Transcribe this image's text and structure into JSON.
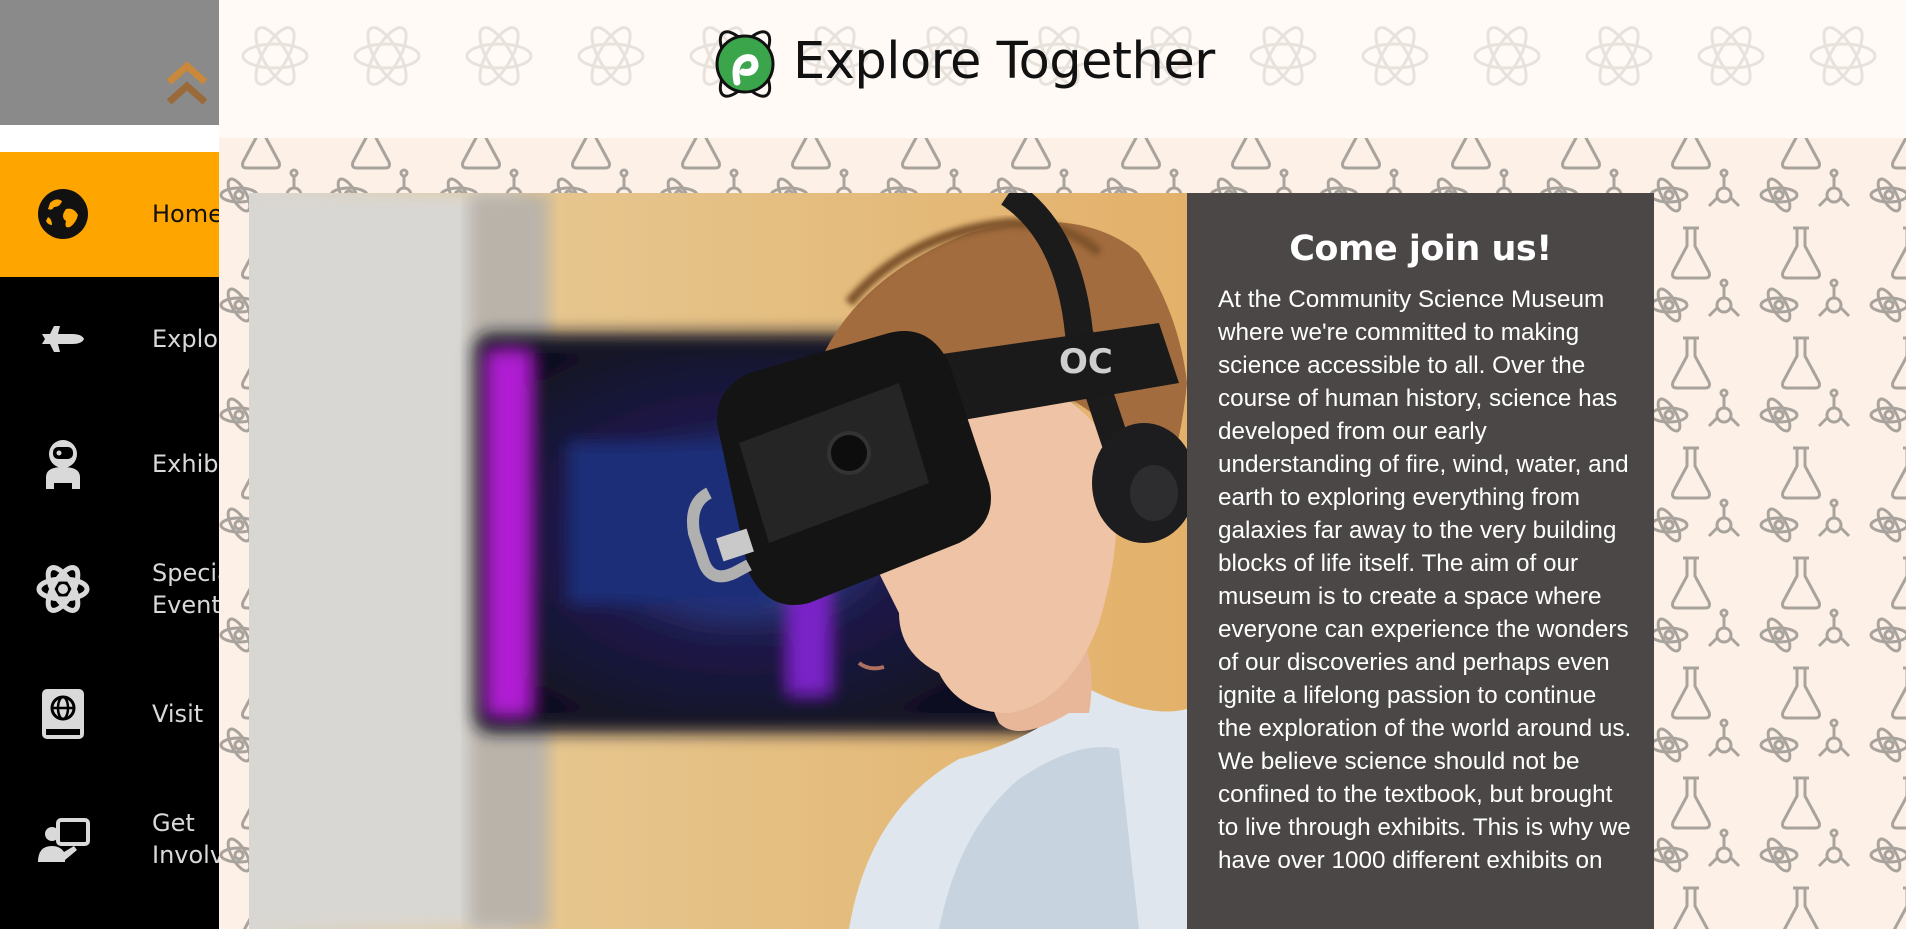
{
  "header": {
    "title": "Explore Together"
  },
  "sidebar": {
    "items": [
      {
        "label": "Home",
        "icon": "globe-icon",
        "active": true
      },
      {
        "label": "Explore",
        "icon": "space-shuttle-icon",
        "active": false
      },
      {
        "label": "Exhibits",
        "icon": "astronaut-icon",
        "active": false
      },
      {
        "label_line1": "Special",
        "label_line2": "Events",
        "icon": "atom-icon",
        "active": false
      },
      {
        "label": "Visit",
        "icon": "globe-book-icon",
        "active": false
      },
      {
        "label_line1": "Get",
        "label_line2": "Involved",
        "icon": "user-presentation-icon",
        "active": false
      }
    ]
  },
  "hero": {
    "heading": "Come join us!",
    "body": "At the Community Science Museum where we're committed to making science accessible to all. Over the course of human history, science has developed from our early understanding of fire, wind, water, and earth to exploring everything from galaxies far away to the very building blocks of life itself. The aim of our museum is to create a space where everyone can experience the wonders of our discoveries and perhaps even ignite a lifelong passion to continue the exploration of the world around us. We believe science should not be confined to the textbook, but brought to live through exhibits. This is why we have over 1000 different exhibits on"
  },
  "colors": {
    "accent": "#ffa500",
    "sidebar_bg": "#000000",
    "sidebar_top_bg": "#8a8a8a",
    "panel_bg": "#4b4746",
    "logo_green": "#3aa54a"
  }
}
